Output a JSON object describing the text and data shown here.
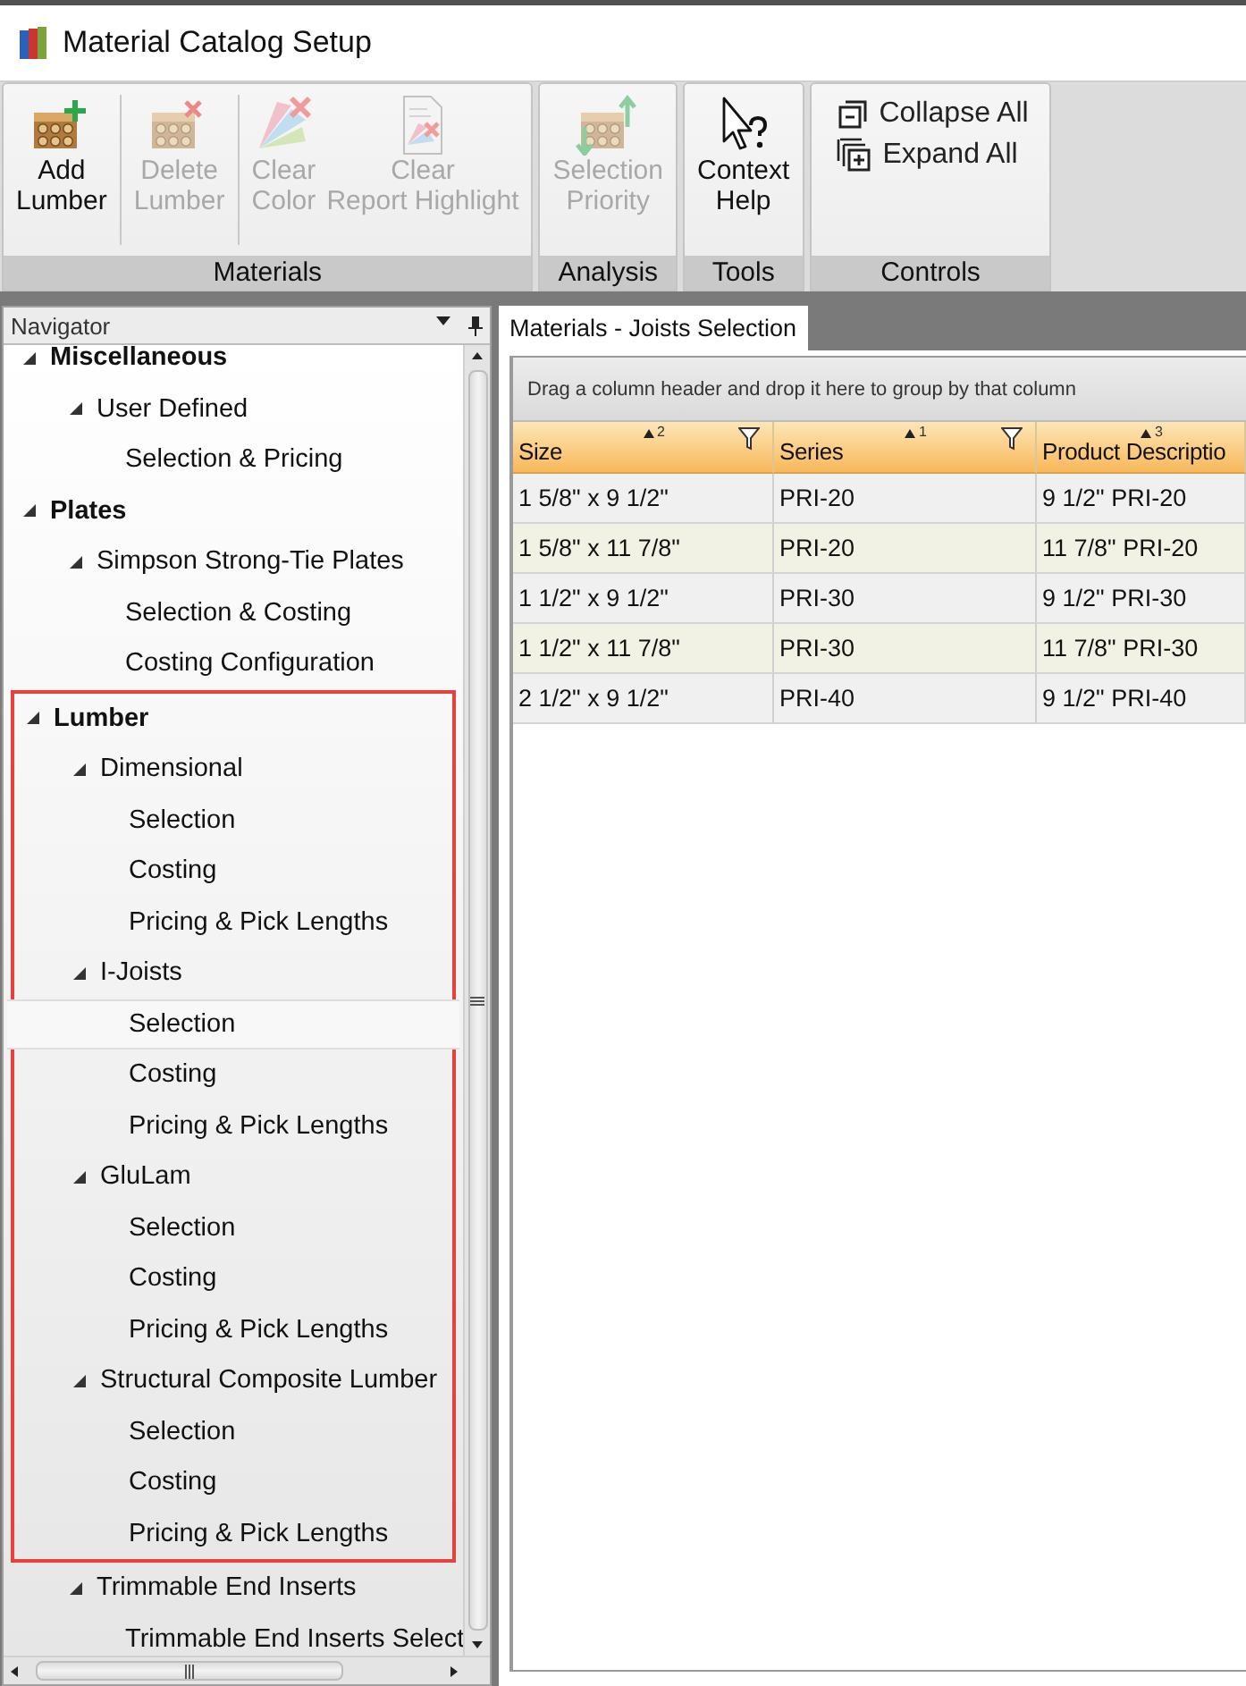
{
  "window": {
    "title": "Material Catalog Setup"
  },
  "ribbon": {
    "groups": [
      {
        "label": "Materials",
        "buttons": [
          {
            "kind": "add",
            "lines": [
              "Add",
              "Lumber"
            ],
            "disabled": false
          },
          {
            "kind": "separator"
          },
          {
            "kind": "delete",
            "lines": [
              "Delete",
              "Lumber"
            ],
            "disabled": true
          },
          {
            "kind": "separator"
          },
          {
            "kind": "clear_color",
            "lines": [
              "Clear",
              "Color"
            ],
            "disabled": true
          },
          {
            "kind": "clear_report",
            "lines": [
              "Clear",
              "Report Highlight"
            ],
            "disabled": true
          }
        ]
      },
      {
        "label": "Analysis",
        "buttons": [
          {
            "kind": "priority",
            "lines": [
              "Selection",
              "Priority"
            ],
            "disabled": true
          }
        ]
      },
      {
        "label": "Tools",
        "buttons": [
          {
            "kind": "help",
            "lines": [
              "Context",
              "Help"
            ],
            "disabled": false
          }
        ]
      },
      {
        "label": "Controls",
        "buttons": [
          {
            "kind": "collapse",
            "lines": [
              "Collapse All"
            ],
            "disabled": false
          },
          {
            "kind": "expand",
            "lines": [
              "Expand All"
            ],
            "disabled": false
          }
        ]
      }
    ]
  },
  "navigator": {
    "title": "Navigator",
    "items": [
      {
        "label": "Miscellaneous",
        "expanded": true,
        "selected": false,
        "outlined": false,
        "children": [
          {
            "label": "User Defined",
            "expanded": true,
            "selected": false,
            "children": [
              {
                "label": "Selection & Pricing",
                "selected": false
              }
            ]
          }
        ]
      },
      {
        "label": "Plates",
        "expanded": true,
        "selected": false,
        "outlined": false,
        "children": [
          {
            "label": "Simpson Strong-Tie Plates",
            "expanded": true,
            "selected": false,
            "children": [
              {
                "label": "Selection & Costing",
                "selected": false
              },
              {
                "label": "Costing Configuration",
                "selected": false
              }
            ]
          }
        ]
      },
      {
        "label": "Lumber",
        "expanded": true,
        "selected": false,
        "outlined": true,
        "children": [
          {
            "label": "Dimensional",
            "expanded": true,
            "selected": false,
            "children": [
              {
                "label": "Selection",
                "selected": false
              },
              {
                "label": "Costing",
                "selected": false
              },
              {
                "label": "Pricing & Pick Lengths",
                "selected": false
              }
            ]
          },
          {
            "label": "I-Joists",
            "expanded": true,
            "selected": false,
            "children": [
              {
                "label": "Selection",
                "selected": true
              },
              {
                "label": "Costing",
                "selected": false
              },
              {
                "label": "Pricing & Pick Lengths",
                "selected": false
              }
            ]
          },
          {
            "label": "GluLam",
            "expanded": true,
            "selected": false,
            "children": [
              {
                "label": "Selection",
                "selected": false
              },
              {
                "label": "Costing",
                "selected": false
              },
              {
                "label": "Pricing & Pick Lengths",
                "selected": false
              }
            ]
          },
          {
            "label": "Structural Composite Lumber",
            "expanded": true,
            "selected": false,
            "children": [
              {
                "label": "Selection",
                "selected": false
              },
              {
                "label": "Costing",
                "selected": false
              },
              {
                "label": "Pricing & Pick Lengths",
                "selected": false
              }
            ]
          },
          {
            "label": "Trimmable End Inserts",
            "expanded": true,
            "selected": false,
            "outlined": false,
            "children": [
              {
                "label": "Trimmable End Inserts Select",
                "selected": false
              }
            ]
          }
        ]
      }
    ]
  },
  "tabs": [
    {
      "label": "Materials - Joists Selection",
      "selected": true
    }
  ],
  "grid": {
    "group_hint": "Drag a column header and drop it here to group by that column",
    "columns": [
      {
        "label": "Size",
        "sort_order": "2",
        "filter": true
      },
      {
        "label": "Series",
        "sort_order": "1",
        "filter": true
      },
      {
        "label": "Product Descriptio",
        "sort_order": "3",
        "filter": false
      }
    ],
    "rows": [
      [
        "1 5/8\" x 9 1/2\"",
        "PRI-20",
        "9 1/2\" PRI-20"
      ],
      [
        "1 5/8\" x 11 7/8\"",
        "PRI-20",
        "11 7/8\" PRI-20"
      ],
      [
        "1 1/2\" x 9 1/2\"",
        "PRI-30",
        "9 1/2\" PRI-30"
      ],
      [
        "1 1/2\" x 11 7/8\"",
        "PRI-30",
        "11 7/8\" PRI-30"
      ],
      [
        "2 1/2\" x 9 1/2\"",
        "PRI-40",
        "9 1/2\" PRI-40"
      ]
    ]
  }
}
